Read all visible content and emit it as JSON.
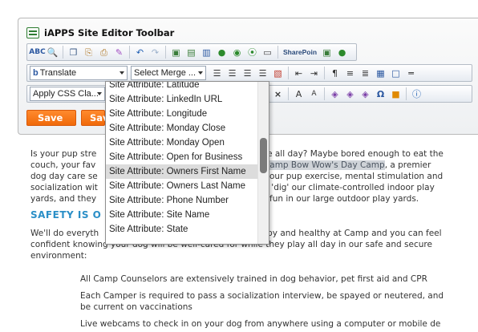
{
  "toolbar_panel": {
    "title": "iAPPS Site Editor Toolbar",
    "row1_sharepoint_label": "SharePoin",
    "translate_select": "Translate",
    "merge_select": "Select Merge ...",
    "css_select": "Apply CSS Cla...",
    "save_label": "Save",
    "save2_label": "Sav"
  },
  "merge_dropdown": {
    "items": [
      "Site Attribute: Latitude",
      "Site Attribute: LinkedIn URL",
      "Site Attribute: Longitude",
      "Site Attribute: Monday Close",
      "Site Attribute: Monday Open",
      "Site Attribute: Open for Business",
      "Site Attribute: Owners First Name",
      "Site Attribute: Owners Last Name",
      "Site Attribute: Phone Number",
      "Site Attribute: Site Name",
      "Site Attribute: State"
    ],
    "highlighted_index": 6
  },
  "content": {
    "p1_lines": [
      {
        "left": "Is your pup stre",
        "right": "one all day? Maybe bored enough to eat the"
      },
      {
        "left": "couch, your fav",
        "right": "? ",
        "hl": "Camp Bow Wow's Day Camp",
        "after": ", a premier"
      },
      {
        "left": "dog day care se",
        "right": "e your pup exercise, mental stimulation and"
      },
      {
        "left": "socialization wit",
        "right": "vill 'dig' our climate-controlled indoor play"
      },
      {
        "left": "yards, and they",
        "right": "ve fun in our large outdoor play yards."
      }
    ],
    "heading": "SAFETY IS O",
    "p2_lines": [
      {
        "left": "We'll do everyth",
        "right": "appy and healthy at Camp and you can feel"
      },
      {
        "left": "confident knowing your dog will be well-cared for while they play all day in our safe and secure"
      },
      {
        "left": "environment:"
      }
    ],
    "list_items": [
      "All Camp Counselors are extensively trained in dog behavior, pet first aid and CPR",
      "Each Camper is required to pass a socialization interview, be spayed or neutered, and",
      "be current on vaccinations",
      "Live webcams to check in on your dog from anywhere using a computer or mobile de"
    ]
  }
}
